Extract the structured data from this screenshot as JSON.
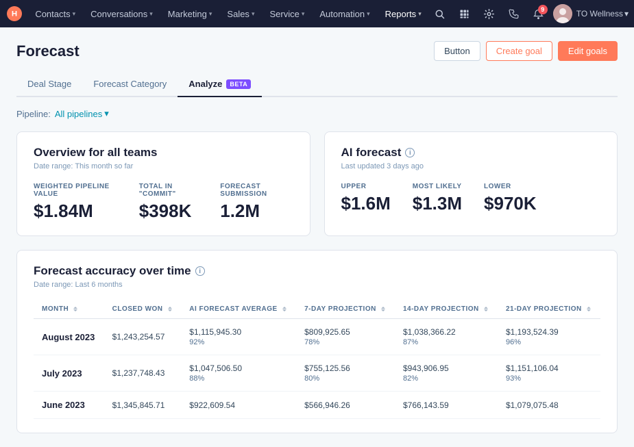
{
  "nav": {
    "logo_label": "HubSpot",
    "items": [
      {
        "label": "Contacts",
        "has_dropdown": true
      },
      {
        "label": "Conversations",
        "has_dropdown": true
      },
      {
        "label": "Marketing",
        "has_dropdown": true
      },
      {
        "label": "Sales",
        "has_dropdown": true
      },
      {
        "label": "Service",
        "has_dropdown": true
      },
      {
        "label": "Automation",
        "has_dropdown": true
      },
      {
        "label": "Reports",
        "has_dropdown": true,
        "active": true
      }
    ],
    "workspace": "TO Wellness",
    "notif_count": "9"
  },
  "header": {
    "title": "Forecast",
    "btn_button": "Button",
    "btn_create_goal": "Create goal",
    "btn_edit_goals": "Edit goals"
  },
  "tabs": [
    {
      "label": "Deal Stage",
      "active": false,
      "beta": false
    },
    {
      "label": "Forecast Category",
      "active": false,
      "beta": false
    },
    {
      "label": "Analyze",
      "active": true,
      "beta": true
    }
  ],
  "pipeline": {
    "label": "Pipeline:",
    "value": "All pipelines",
    "chevron": "▾"
  },
  "overview_card": {
    "title": "Overview for all teams",
    "subtitle": "Date range: This month so far",
    "metrics": [
      {
        "label": "WEIGHTED PIPELINE VALUE",
        "value": "$1.84M"
      },
      {
        "label": "TOTAL IN \"COMMIT\"",
        "value": "$398K"
      },
      {
        "label": "FORECAST SUBMISSION",
        "value": "1.2M"
      }
    ]
  },
  "ai_card": {
    "title": "AI forecast",
    "subtitle": "Last updated 3 days ago",
    "metrics": [
      {
        "label": "UPPER",
        "value": "$1.6M"
      },
      {
        "label": "MOST LIKELY",
        "value": "$1.3M"
      },
      {
        "label": "LOWER",
        "value": "$970K"
      }
    ]
  },
  "accuracy_table": {
    "title": "Forecast accuracy over time",
    "subtitle": "Date range: Last 6 months",
    "columns": [
      {
        "label": "MONTH",
        "sort": true
      },
      {
        "label": "CLOSED WON",
        "sort": true
      },
      {
        "label": "AI FORECAST AVERAGE",
        "sort": true
      },
      {
        "label": "7-DAY PROJECTION",
        "sort": true
      },
      {
        "label": "14-DAY PROJECTION",
        "sort": true
      },
      {
        "label": "21-DAY PROJECTION",
        "sort": true
      }
    ],
    "rows": [
      {
        "month": "August 2023",
        "closed_won": "$1,243,254.57",
        "ai_forecast": "$1,115,945.30",
        "ai_forecast_pct": "92%",
        "day7": "$809,925.65",
        "day7_pct": "78%",
        "day14": "$1,038,366.22",
        "day14_pct": "87%",
        "day21": "$1,193,524.39",
        "day21_pct": "96%"
      },
      {
        "month": "July 2023",
        "closed_won": "$1,237,748.43",
        "ai_forecast": "$1,047,506.50",
        "ai_forecast_pct": "88%",
        "day7": "$755,125.56",
        "day7_pct": "80%",
        "day14": "$943,906.95",
        "day14_pct": "82%",
        "day21": "$1,151,106.04",
        "day21_pct": "93%"
      },
      {
        "month": "June 2023",
        "closed_won": "$1,345,845.71",
        "ai_forecast": "$922,609.54",
        "ai_forecast_pct": "",
        "day7": "$566,946.26",
        "day7_pct": "",
        "day14": "$766,143.59",
        "day14_pct": "",
        "day21": "$1,079,075.48",
        "day21_pct": ""
      }
    ]
  }
}
